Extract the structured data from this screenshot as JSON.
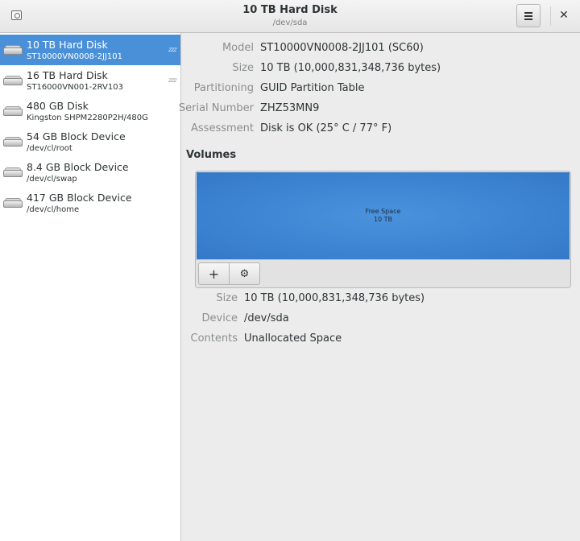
{
  "header": {
    "title": "10 TB Hard Disk",
    "subtitle": "/dev/sda",
    "app_icon": "disks-app-icon",
    "menu_icon": "hamburger-menu-icon",
    "close_label": "✕"
  },
  "sidebar": {
    "items": [
      {
        "name": "10 TB Hard Disk",
        "detail": "ST10000VN0008-2JJ101",
        "selected": true,
        "standby": "zzz"
      },
      {
        "name": "16 TB Hard Disk",
        "detail": "ST16000VN001-2RV103",
        "selected": false,
        "standby": "zzz"
      },
      {
        "name": "480 GB Disk",
        "detail": "Kingston SHPM2280P2H/480G",
        "selected": false
      },
      {
        "name": "54 GB Block Device",
        "detail": "/dev/cl/root",
        "selected": false
      },
      {
        "name": "8.4 GB Block Device",
        "detail": "/dev/cl/swap",
        "selected": false
      },
      {
        "name": "417 GB Block Device",
        "detail": "/dev/cl/home",
        "selected": false
      }
    ]
  },
  "disk_info": {
    "model_label": "Model",
    "model": "ST10000VN0008-2JJ101 (SC60)",
    "size_label": "Size",
    "size": "10 TB (10,000,831,348,736 bytes)",
    "partitioning_label": "Partitioning",
    "partitioning": "GUID Partition Table",
    "serial_label": "Serial Number",
    "serial": "ZHZ53MN9",
    "assessment_label": "Assessment",
    "assessment": "Disk is OK (25° C / 77° F)"
  },
  "volumes": {
    "heading": "Volumes",
    "block_line1": "Free Space",
    "block_line2": "10 TB",
    "add_label": "+",
    "gear_label": "⚙",
    "block_color": "#3c84d2"
  },
  "volume_info": {
    "size_label": "Size",
    "size": "10 TB (10,000,831,348,736 bytes)",
    "device_label": "Device",
    "device": "/dev/sda",
    "contents_label": "Contents",
    "contents": "Unallocated Space"
  },
  "colors": {
    "selection": "#4a90d9",
    "label_gray": "#8b8e8f"
  }
}
